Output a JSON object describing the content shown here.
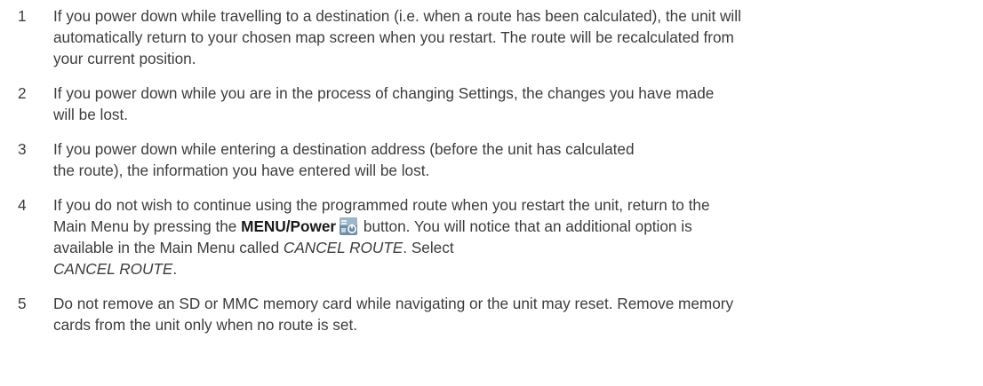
{
  "items": [
    {
      "number": "1",
      "lines": [
        "If you power down while travelling to a destination (i.e. when a route has been calculated), the unit will",
        "automatically return to your chosen map screen when you restart. The route will be recalculated from",
        "your current position."
      ]
    },
    {
      "number": "2",
      "lines": [
        "If you power down while you are in the process of changing Settings, the changes you have made",
        "will be lost."
      ]
    },
    {
      "number": "3",
      "lines": [
        "If you power down while entering a destination address (before the unit has calculated",
        "the route), the information you have entered will be lost."
      ]
    },
    {
      "number": "4",
      "line1": "If you do not wish to continue using the programmed route when you restart the unit, return to the",
      "line2_pre": "Main Menu by pressing the ",
      "line2_bold": "MENU/Power",
      "line2_post": " button. You will notice that an additional option is",
      "line3_pre": "available in the Main Menu called ",
      "line3_ital": "CANCEL ROUTE",
      "line3_post": ". Select",
      "line4_ital": "CANCEL ROUTE",
      "line4_post": ".",
      "icon": "menu-power-icon"
    },
    {
      "number": "5",
      "lines": [
        "Do not remove an SD or MMC memory card while navigating or the unit may reset. Remove memory",
        "cards from the unit only when no route is set."
      ]
    }
  ]
}
